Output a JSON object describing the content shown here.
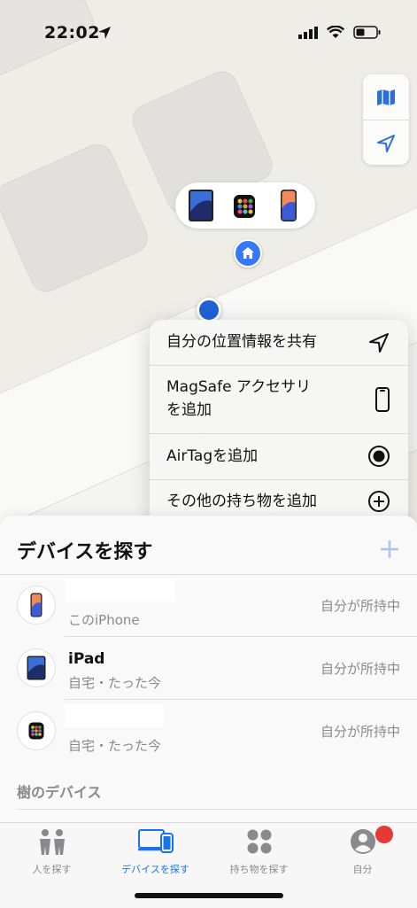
{
  "status_bar": {
    "time": "22:02"
  },
  "map": {
    "controls": {
      "map_mode_icon": "map-icon",
      "locate_icon": "location-arrow-icon"
    },
    "device_bubble_icons": [
      "ipad-icon",
      "watch-icon",
      "iphone-icon"
    ],
    "home_pin_icon": "house-icon"
  },
  "menu": {
    "items": [
      {
        "label": "自分の位置情報を共有",
        "icon": "location-arrow-icon"
      },
      {
        "label": "MagSafe アクセサリ\nを追加",
        "icon": "phone-outline-icon"
      },
      {
        "label": "AirTagを追加",
        "icon": "airtag-icon"
      },
      {
        "label": "その他の持ち物を追加",
        "icon": "plus-circle-icon"
      }
    ]
  },
  "sheet": {
    "title": "デバイスを探す",
    "add_icon": "plus-icon",
    "devices": [
      {
        "name": "",
        "subtitle": "このiPhone",
        "status": "自分が所持中",
        "icon": "iphone-icon"
      },
      {
        "name": "iPad",
        "subtitle": "自宅・たった今",
        "status": "自分が所持中",
        "icon": "ipad-icon"
      },
      {
        "name": "",
        "subtitle": "自宅・たった今",
        "status": "自分が所持中",
        "icon": "watch-icon"
      }
    ],
    "section_header": "樹のデバイス"
  },
  "tabbar": {
    "tabs": [
      {
        "label": "人を探す",
        "icon": "people-icon",
        "active": false
      },
      {
        "label": "デバイスを探す",
        "icon": "devices-icon",
        "active": true
      },
      {
        "label": "持ち物を探す",
        "icon": "items-grid-icon",
        "active": false
      },
      {
        "label": "自分",
        "icon": "person-circle-icon",
        "active": false
      }
    ]
  },
  "colors": {
    "accent": "#1a73e8",
    "badge": "#e53935",
    "pin": "#3478f6"
  }
}
